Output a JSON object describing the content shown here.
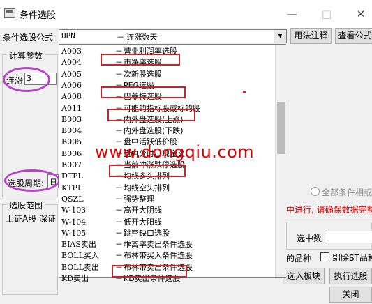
{
  "window": {
    "title": "条件选股",
    "minimize_glyph": "—",
    "maximize_glyph": "□",
    "close_glyph": "✕"
  },
  "formula": {
    "label": "条件选股公式",
    "selected_code": "UPN",
    "selected_desc": "－ 连涨数天",
    "usage_button": "用法注释",
    "view_button": "查看公式"
  },
  "params": {
    "group_title": "计算参数",
    "lianzhang_label": "连涨",
    "lianzhang_value": "3",
    "period_label": "选股周期:",
    "period_value": "日"
  },
  "scope": {
    "group_title": "选股范围",
    "items_text": "上证A股 深证"
  },
  "dropdown_items": [
    {
      "code": "A003",
      "desc": "营业利润率选股"
    },
    {
      "code": "A004",
      "desc": "市净率选股"
    },
    {
      "code": "A005",
      "desc": "次新股选股"
    },
    {
      "code": "A006",
      "desc": "PEG选股"
    },
    {
      "code": "A008",
      "desc": "巴菲特选股"
    },
    {
      "code": "A011",
      "desc": "可能的指标股或标的股"
    },
    {
      "code": "B003",
      "desc": "内外盘选股(上涨)"
    },
    {
      "code": "B004",
      "desc": "内外盘选股(下跌)"
    },
    {
      "code": "B005",
      "desc": "盘中活跃低价股"
    },
    {
      "code": "B006",
      "desc": "盘中分时出现金叉"
    },
    {
      "code": "B007",
      "desc": "当前冲涨跌停选股"
    },
    {
      "code": "DTPL",
      "desc": "均线多头排列"
    },
    {
      "code": "KTPL",
      "desc": "均线空头排列"
    },
    {
      "code": "QSZL",
      "desc": "强势整理"
    },
    {
      "code": "W-103",
      "desc": "高开大阴线"
    },
    {
      "code": "W-104",
      "desc": "低开大阳线"
    },
    {
      "code": "W-105",
      "desc": "跳空缺口选股"
    },
    {
      "code": "BIAS卖出",
      "desc": "乖离率卖出条件选股"
    },
    {
      "code": "BOLL买入",
      "desc": "布林带买入条件选股"
    },
    {
      "code": "BOLL卖出",
      "desc": "布林带卖出条件选股"
    },
    {
      "code": "KD卖出",
      "desc": "KD卖出条件选股"
    }
  ],
  "dash": "－",
  "right_panel": {
    "all_conditions_radio": "全部条件相或",
    "warning_text": "中进行, 请确保数据完整",
    "selected_count_label": "选中数",
    "varieties_text": "的品种",
    "exclude_st_label": "剔除ST品种",
    "add_block_button": "选入板块",
    "run_button": "执行选股",
    "close_button": "关闭"
  },
  "watermark": "www.dongqiu.com",
  "colors": {
    "highlight_box": "#c0272d",
    "ellipse": "#b542c7",
    "watermark": "#e30000"
  }
}
